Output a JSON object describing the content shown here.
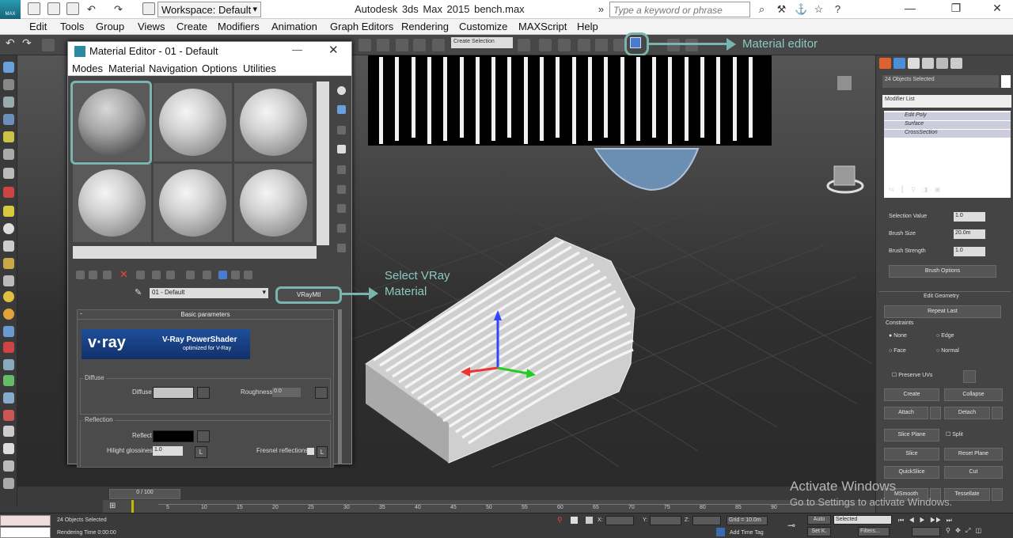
{
  "app": {
    "logo_text": "MAX",
    "workspace": "Workspace: Default",
    "title": "Autodesk 3ds Max  2015    bench.max",
    "search_placeholder": "Type a keyword or phrase"
  },
  "menubar": [
    "Edit",
    "Tools",
    "Group",
    "Views",
    "Create",
    "Modifiers",
    "Animation",
    "Graph Editors",
    "Rendering",
    "Customize",
    "MAXScript",
    "Help"
  ],
  "toolbar": {
    "selection_set": "Create Selection"
  },
  "callouts": {
    "material_editor": "Material editor",
    "select_vray": "Select VRay",
    "select_vray_line2": "Material"
  },
  "material_editor": {
    "title": "Material Editor - 01 - Default",
    "menu": [
      "Modes",
      "Material",
      "Navigation",
      "Options",
      "Utilities"
    ],
    "material_name": "01 - Default",
    "material_type": "VRayMtl",
    "rollout_title": "Basic parameters",
    "vray_logo": "v·ray",
    "vray_powershader": "V-Ray PowerShader",
    "vray_optimized": "optimized for V-Ray",
    "diffuse_group": "Diffuse",
    "diffuse_label": "Diffuse",
    "roughness_label": "Roughness",
    "roughness_value": "0.0",
    "reflection_group": "Reflection",
    "reflect_label": "Reflect",
    "hilight_label": "Hilight glossiness",
    "hilight_value": "1.0",
    "fresnel_label": "Fresnel reflections",
    "l_button": "L",
    "l_button2": "L",
    "diffuse_color": "#c4c4c4",
    "reflect_color": "#000000"
  },
  "viewport": {
    "label": "",
    "frame": "0 / 100"
  },
  "right_panel": {
    "selection": "24 Objects Selected",
    "modifier_list": "Modifier List",
    "stack": [
      "Edit Poly",
      "Surface",
      "CrossSection"
    ],
    "selection_value_label": "Selection Value",
    "selection_value": "1.0",
    "brush_size_label": "Brush Size",
    "brush_size": "20.0m",
    "brush_strength_label": "Brush Strength",
    "brush_strength": "1.0",
    "brush_options": "Brush Options",
    "edit_geometry": "Edit Geometry",
    "repeat_last": "Repeat Last",
    "constraints": "Constraints",
    "c_none": "None",
    "c_edge": "Edge",
    "c_face": "Face",
    "c_normal": "Normal",
    "preserve_uvs": "Preserve UVs",
    "create": "Create",
    "collapse": "Collapse",
    "attach": "Attach",
    "detach": "Detach",
    "slice_plane": "Slice Plane",
    "split": "Split",
    "slice": "Slice",
    "reset_plane": "Reset Plane",
    "quickslice": "QuickSlice",
    "cut": "Cut",
    "msmooth": "MSmooth",
    "tessellate": "Tessellate"
  },
  "timeline": {
    "ticks": [
      "5",
      "10",
      "15",
      "20",
      "25",
      "30",
      "35",
      "40",
      "45",
      "50",
      "55",
      "60",
      "65",
      "70",
      "75",
      "80",
      "85",
      "90"
    ]
  },
  "status": {
    "objects": "24 Objects Selected",
    "rendering_time": "Rendering Time  0:00:00",
    "x_label": "X:",
    "y_label": "Y:",
    "z_label": "Z:",
    "grid": "Grid = 10.0m",
    "add_time_tag": "Add Time Tag",
    "auto": "Auto",
    "selected": "Selected",
    "set_key": "Set K.",
    "filters": "Filters..."
  },
  "watermark": {
    "line1": "Activate Windows",
    "line2": "Go to Settings to activate Windows."
  }
}
